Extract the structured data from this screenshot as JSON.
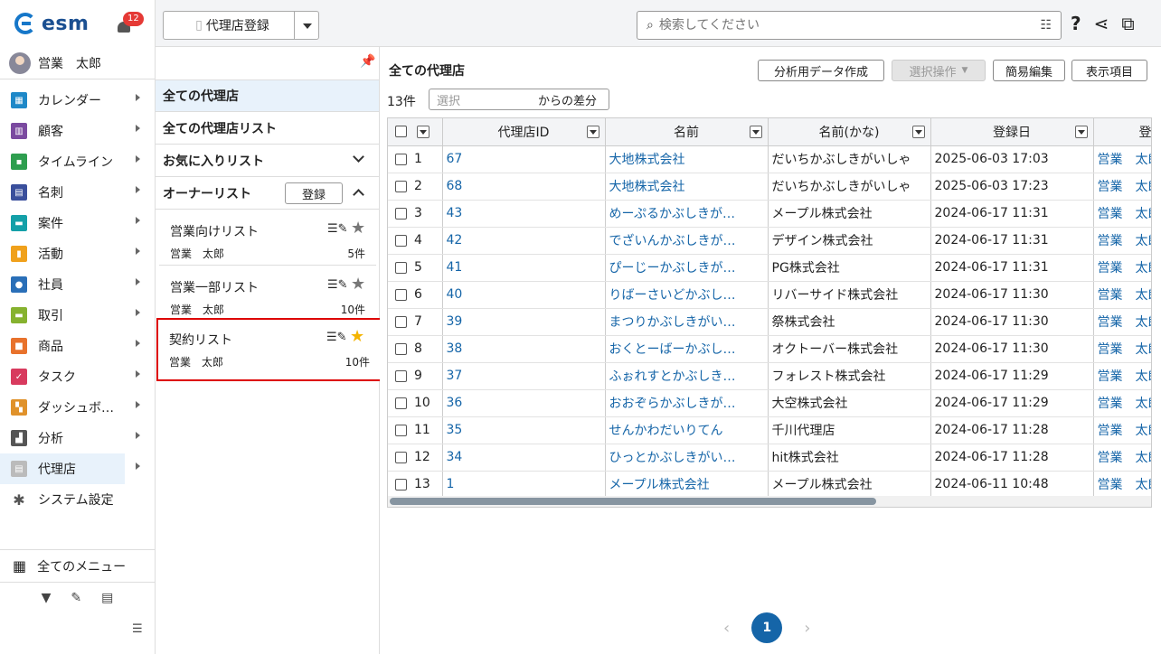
{
  "app": {
    "logo": "esm",
    "notifications": "12",
    "user": "営業　太郎"
  },
  "nav": {
    "items": [
      {
        "label": "カレンダー",
        "icon": "calendar-icon",
        "color": "#1e88c8"
      },
      {
        "label": "顧客",
        "icon": "building-icon",
        "color": "#7b4aa0"
      },
      {
        "label": "タイムライン",
        "icon": "chat-icon",
        "color": "#2e9e4f"
      },
      {
        "label": "名刺",
        "icon": "card-icon",
        "color": "#3a4f9c"
      },
      {
        "label": "案件",
        "icon": "folder-icon",
        "color": "#14a0a8"
      },
      {
        "label": "活動",
        "icon": "clipboard-icon",
        "color": "#f0a11c"
      },
      {
        "label": "社員",
        "icon": "person-icon",
        "color": "#2a6fb8"
      },
      {
        "label": "取引",
        "icon": "document-icon",
        "color": "#86b22f"
      },
      {
        "label": "商品",
        "icon": "box-icon",
        "color": "#e8722c"
      },
      {
        "label": "タスク",
        "icon": "check-icon",
        "color": "#d83a5e"
      },
      {
        "label": "ダッシュボ…",
        "icon": "dashboard-icon",
        "color": "#e0922b"
      },
      {
        "label": "分析",
        "icon": "chart-icon",
        "color": "#555555"
      },
      {
        "label": "代理店",
        "icon": "agency-icon",
        "color": "#bbbbbb"
      },
      {
        "label": "システム設定",
        "icon": "gear-icon",
        "color": "#555555"
      }
    ],
    "all_menu": "全てのメニュー"
  },
  "topbar": {
    "register_label": "代理店登録",
    "search_placeholder": "検索してください"
  },
  "lists": {
    "all": "全ての代理店",
    "all_lists": "全ての代理店リスト",
    "favorites": "お気に入りリスト",
    "owner": "オーナーリスト",
    "owner_register": "登録",
    "cards": [
      {
        "title": "営業向けリスト",
        "owner": "営業　太郎",
        "count": "5件"
      },
      {
        "title": "営業一部リスト",
        "owner": "営業　太郎",
        "count": "10件"
      },
      {
        "title": "契約リスト",
        "owner": "営業　太郎",
        "count": "10件"
      }
    ]
  },
  "main": {
    "title": "全ての代理店",
    "buttons": {
      "export": "分析用データ作成",
      "select_ops": "選択操作",
      "quick_edit": "簡易編集",
      "display": "表示項目"
    },
    "count": "13件",
    "diff_placeholder": "選択",
    "diff_suffix": "からの差分",
    "columns": [
      "代理店ID",
      "名前",
      "名前(かな)",
      "登録日",
      "登"
    ],
    "rows": [
      {
        "n": "1",
        "id": "67",
        "name": "大地株式会社",
        "kana": "だいちかぶしきがいしゃ",
        "date": "2025-06-03 17:03",
        "user": "営業　太郎"
      },
      {
        "n": "2",
        "id": "68",
        "name": "大地株式会社",
        "kana": "だいちかぶしきがいしゃ",
        "date": "2025-06-03 17:23",
        "user": "営業　太郎"
      },
      {
        "n": "3",
        "id": "43",
        "name": "めーぷるかぶしきが…",
        "kana": "メープル株式会社",
        "date": "2024-06-17 11:31",
        "user": "営業　太郎"
      },
      {
        "n": "4",
        "id": "42",
        "name": "でざいんかぶしきが…",
        "kana": "デザイン株式会社",
        "date": "2024-06-17 11:31",
        "user": "営業　太郎"
      },
      {
        "n": "5",
        "id": "41",
        "name": "ぴーじーかぶしきが…",
        "kana": "PG株式会社",
        "date": "2024-06-17 11:31",
        "user": "営業　太郎"
      },
      {
        "n": "6",
        "id": "40",
        "name": "りばーさいどかぶし…",
        "kana": "リバーサイド株式会社",
        "date": "2024-06-17 11:30",
        "user": "営業　太郎"
      },
      {
        "n": "7",
        "id": "39",
        "name": "まつりかぶしきがい…",
        "kana": "祭株式会社",
        "date": "2024-06-17 11:30",
        "user": "営業　太郎"
      },
      {
        "n": "8",
        "id": "38",
        "name": "おくとーばーかぶし…",
        "kana": "オクトーバー株式会社",
        "date": "2024-06-17 11:30",
        "user": "営業　太郎"
      },
      {
        "n": "9",
        "id": "37",
        "name": "ふぉれすとかぶしき…",
        "kana": "フォレスト株式会社",
        "date": "2024-06-17 11:29",
        "user": "営業　太郎"
      },
      {
        "n": "10",
        "id": "36",
        "name": "おおぞらかぶしきが…",
        "kana": "大空株式会社",
        "date": "2024-06-17 11:29",
        "user": "営業　太郎"
      },
      {
        "n": "11",
        "id": "35",
        "name": "せんかわだいりてん",
        "kana": "千川代理店",
        "date": "2024-06-17 11:28",
        "user": "営業　太郎"
      },
      {
        "n": "12",
        "id": "34",
        "name": "ひっとかぶしきがい…",
        "kana": "hit株式会社",
        "date": "2024-06-17 11:28",
        "user": "営業　太郎"
      },
      {
        "n": "13",
        "id": "1",
        "name": "メープル株式会社",
        "kana": "メープル株式会社",
        "date": "2024-06-11 10:48",
        "user": "営業　太郎"
      }
    ],
    "page": "1"
  }
}
